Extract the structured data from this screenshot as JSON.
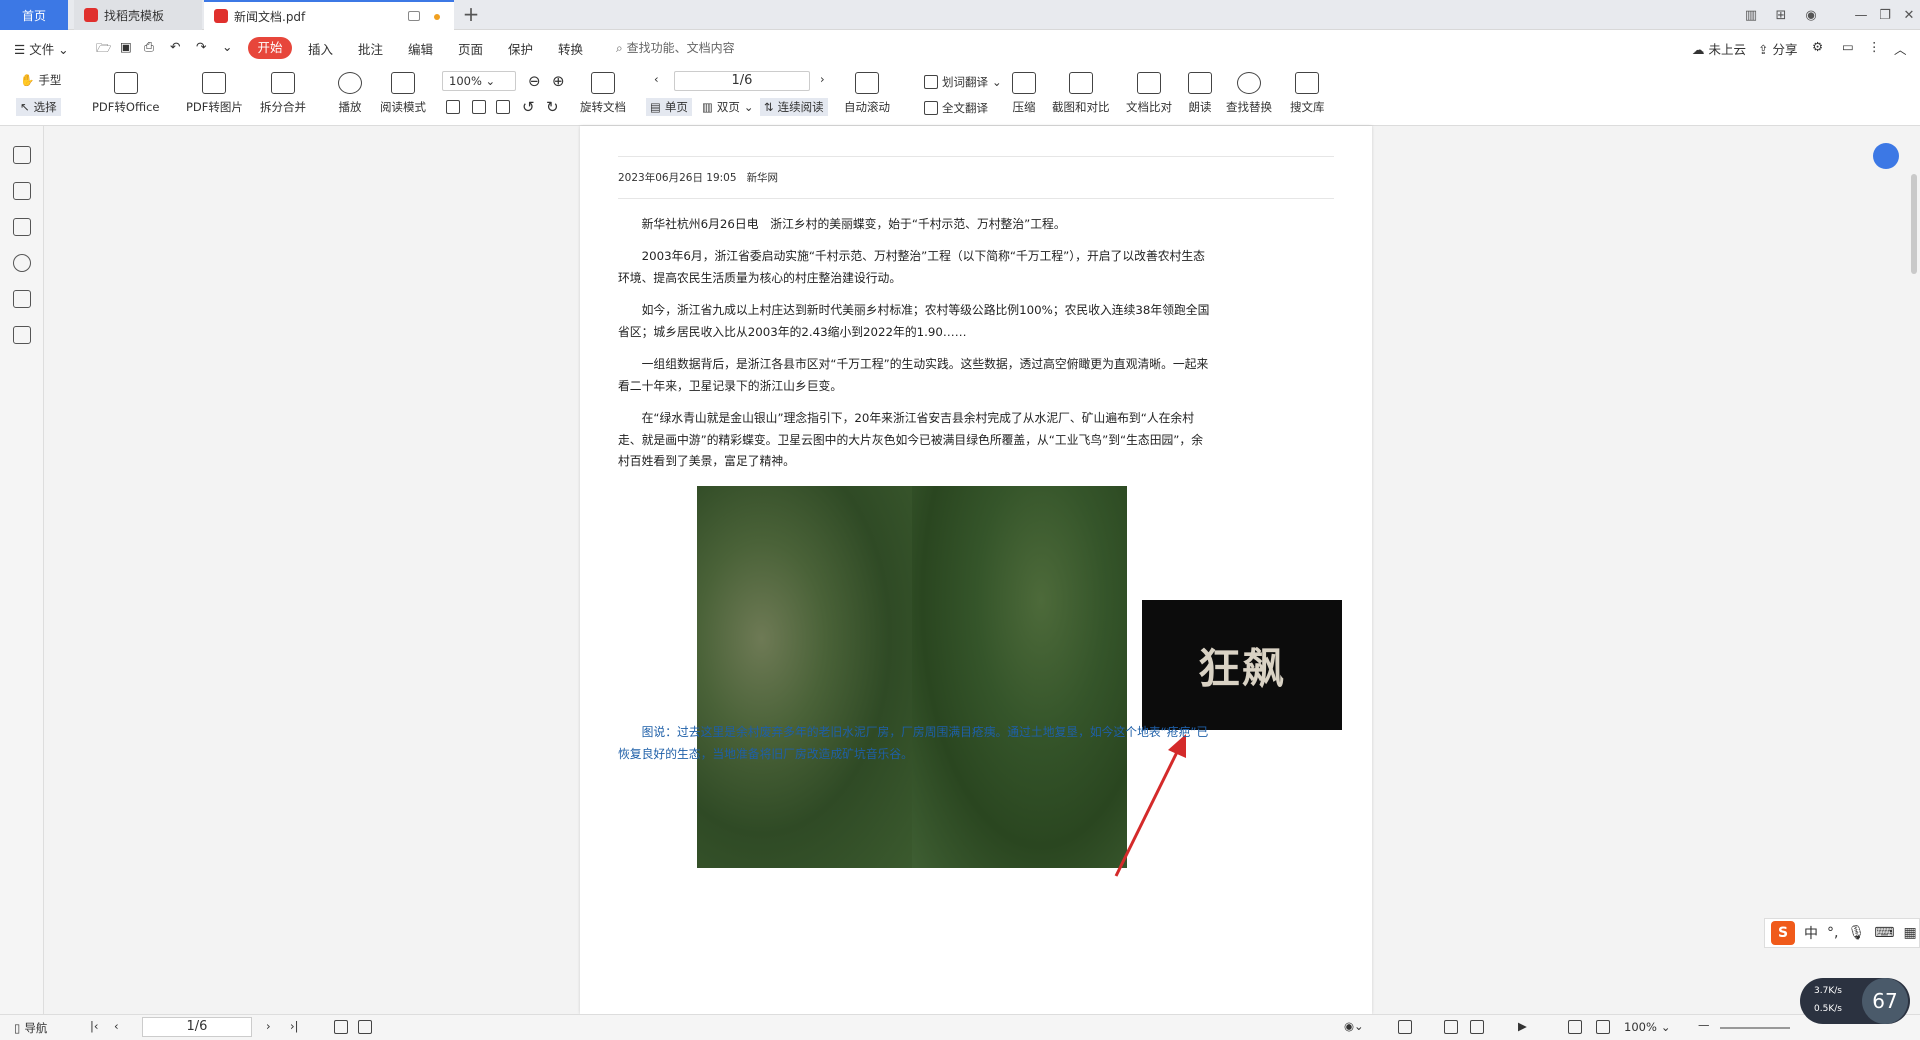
{
  "tabs": {
    "home": "首页",
    "tab1": "找稻壳模板",
    "tab2": "新闻文档.pdf"
  },
  "menu": {
    "file": "文件",
    "start": "开始",
    "insert": "插入",
    "comment": "批注",
    "edit": "编辑",
    "page": "页面",
    "protect": "保护",
    "convert": "转换",
    "search_placeholder": "查找功能、文档内容",
    "cloud": "未上云",
    "share": "分享"
  },
  "ribbon": {
    "hand": "手型",
    "select": "选择",
    "pdf_office": "PDF转Office",
    "pdf_img": "PDF转图片",
    "split": "拆分合并",
    "play": "播放",
    "read_mode": "阅读模式",
    "zoom": "100%",
    "rotate": "旋转文档",
    "page_indicator": "1/6",
    "single": "单页",
    "double": "双页",
    "continuous": "连续阅读",
    "autoscroll": "自动滚动",
    "word_trans": "划词翻译",
    "full_trans": "全文翻译",
    "compress": "压缩",
    "screenshot": "截图和对比",
    "compare": "文档比对",
    "read_aloud": "朗读",
    "find_replace": "查找替换",
    "search_lib": "搜文库"
  },
  "document": {
    "date": "2023年06月26日 19:05",
    "source": "新华网",
    "paragraphs": [
      "新华社杭州6月26日电　浙江乡村的美丽蝶变，始于“千村示范、万村整治”工程。",
      "2003年6月，浙江省委启动实施“千村示范、万村整治”工程（以下简称“千万工程”），开启了以改善农村生态环境、提高农民生活质量为核心的村庄整治建设行动。",
      "如今，浙江省九成以上村庄达到新时代美丽乡村标准；农村等级公路比例100%；农民收入连续38年领跑全国省区；城乡居民收入比从2003年的2.43缩小到2022年的1.90……",
      "一组组数据背后，是浙江各县市区对“千万工程”的生动实践。这些数据，透过高空俯瞰更为直观清晰。一起来看二十年来，卫星记录下的浙江山乡巨变。",
      "在“绿水青山就是金山银山”理念指引下，20年来浙江省安吉县余村完成了从水泥厂、矿山遍布到“人在余村走、就是画中游”的精彩蝶变。卫星云图中的大片灰色如今已被满目绿色所覆盖，从“工业飞鸟”到“生态田园”，余村百姓看到了美景，富足了精神。"
    ],
    "caption": "图说：过去这里是余村废弃多年的老旧水泥厂房，厂房周围满目疮痍。通过土地复垦，如今这个地表“疮疤”已恢复良好的生态，当地准备将旧厂房改造成矿坑音乐谷。",
    "thumb_text": "狂飙"
  },
  "status": {
    "nav": "导航",
    "page": "1/6",
    "zoom": "100%"
  },
  "ime": {
    "lang": "中"
  },
  "net": {
    "up": "3.7K/s",
    "down": "0.5K/s",
    "percent": "67"
  }
}
